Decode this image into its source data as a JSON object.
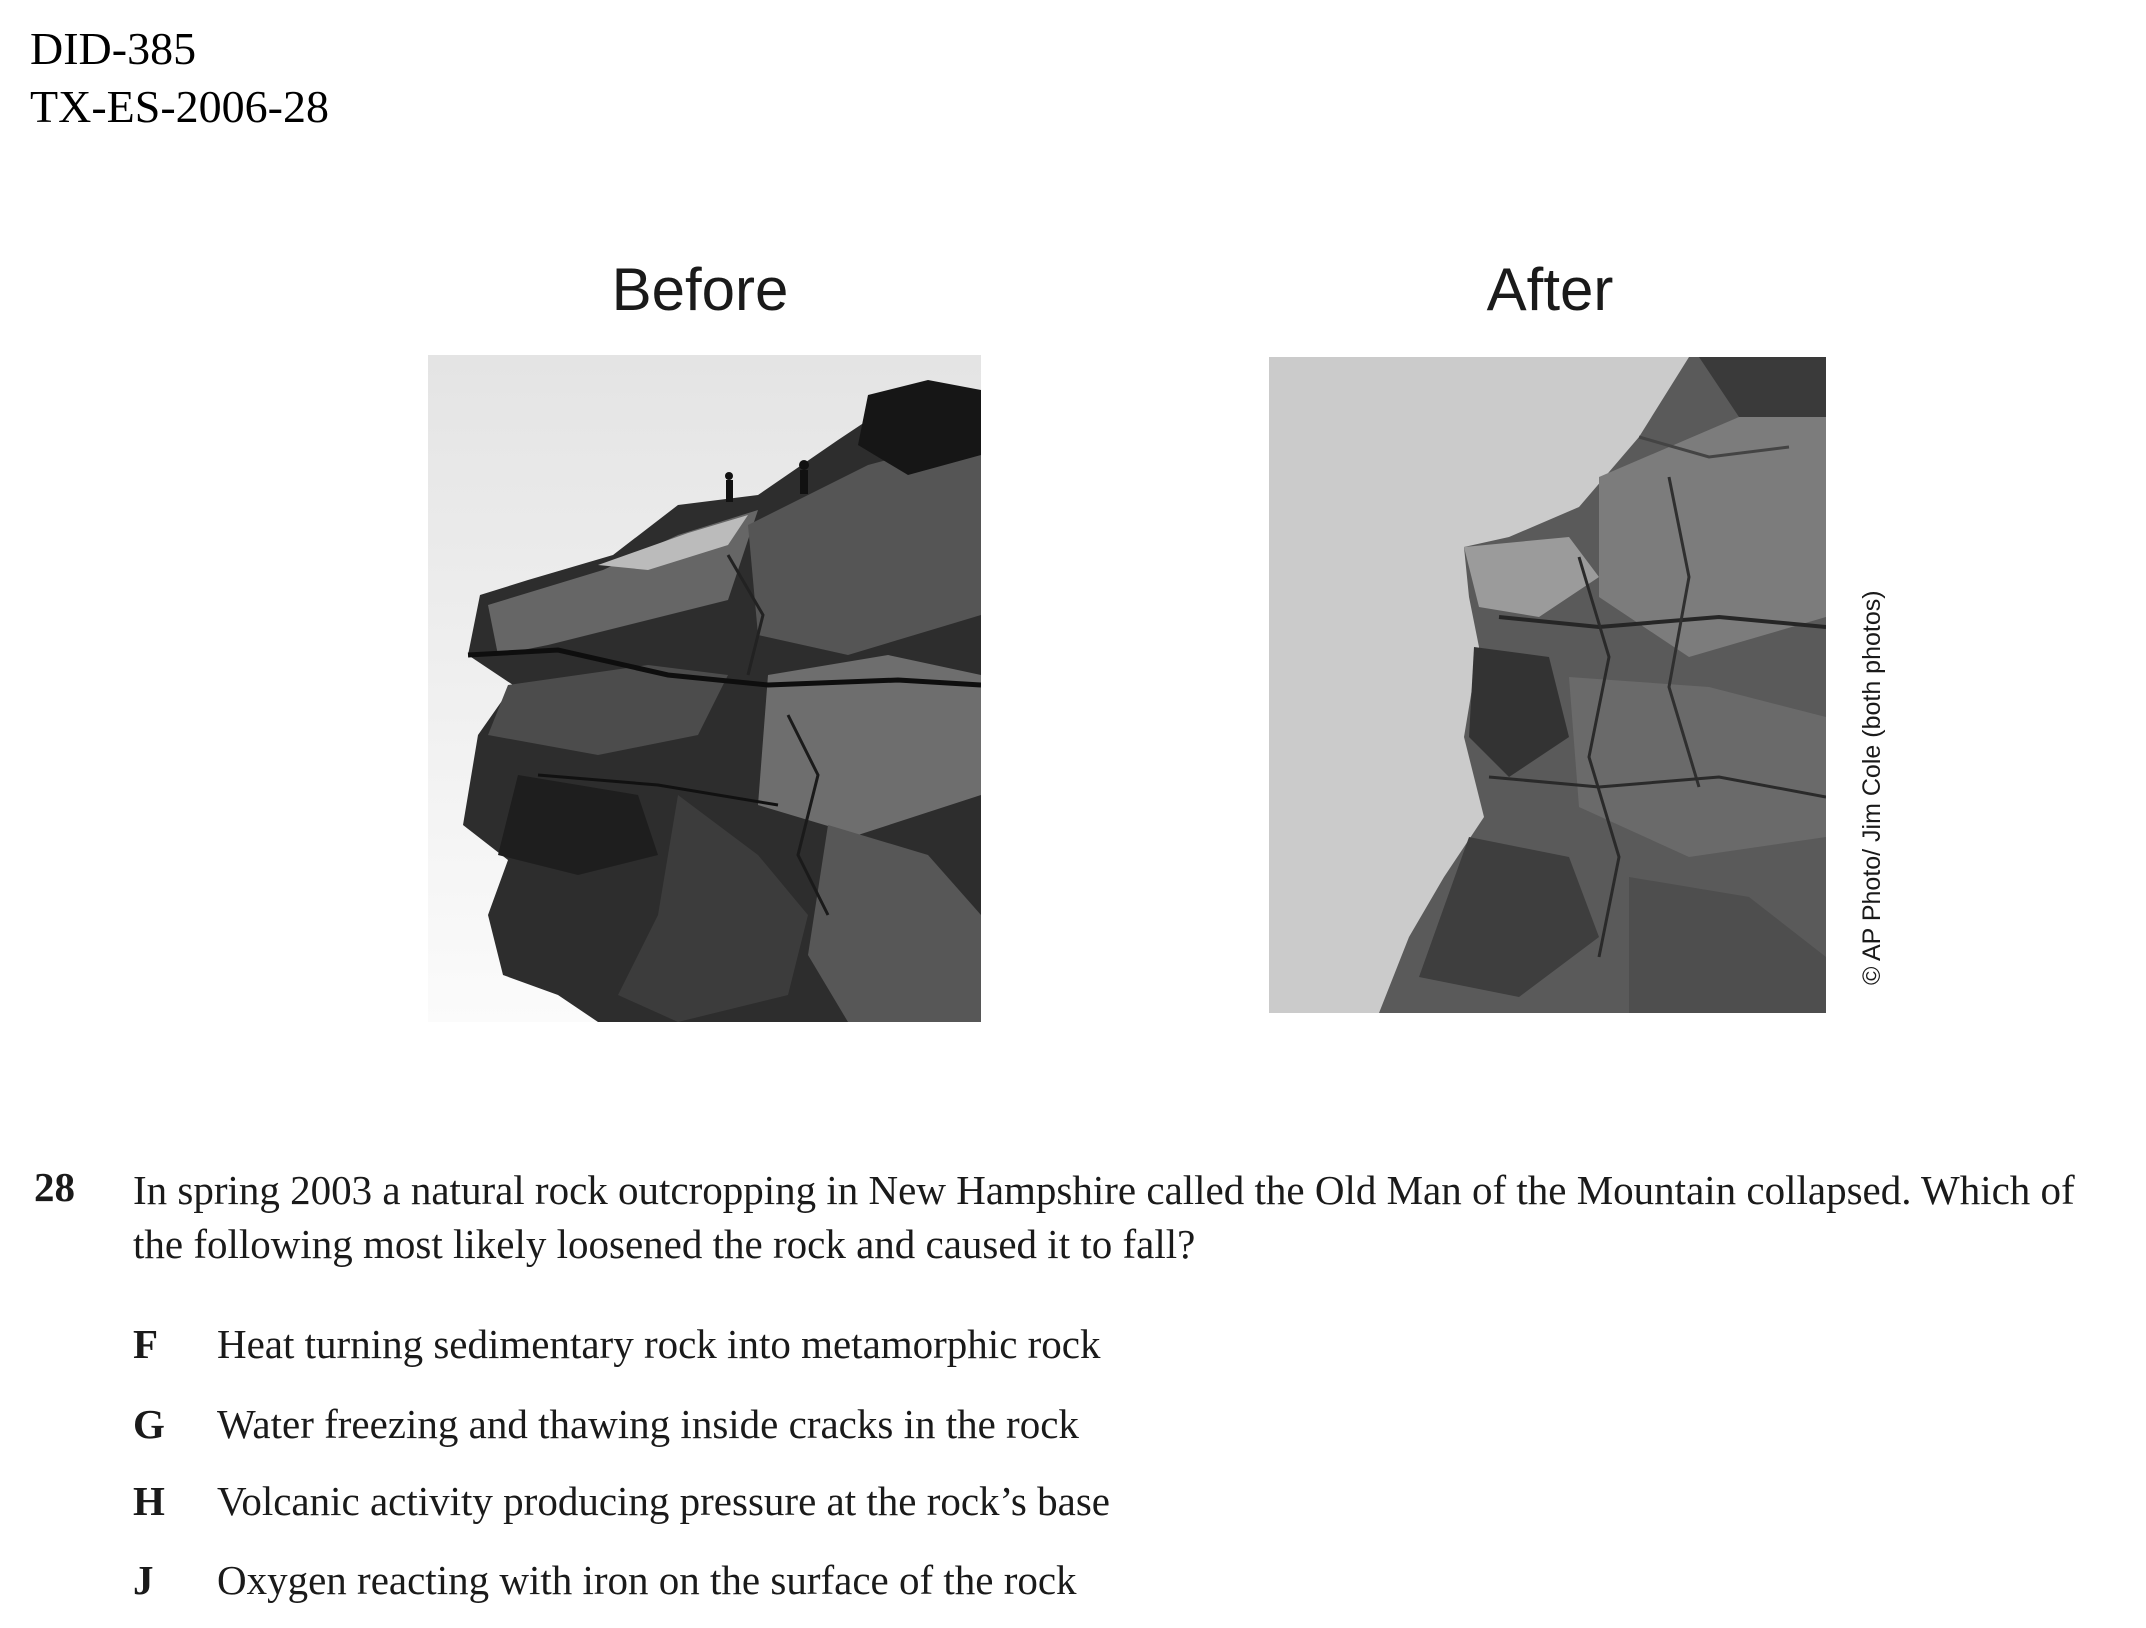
{
  "header": {
    "line1": "DID-385",
    "line2": "TX-ES-2006-28"
  },
  "figure": {
    "before_caption": "Before",
    "after_caption": "After",
    "photo_credit": "© AP Photo/ Jim Cole (both photos)"
  },
  "question": {
    "number": "28",
    "text": "In spring 2003 a natural rock outcropping in New Hampshire called the Old Man of the Mountain collapsed. Which of the following most likely loosened the rock and caused it to fall?",
    "options": [
      {
        "letter": "F",
        "text": "Heat turning sedimentary rock into metamorphic rock"
      },
      {
        "letter": "G",
        "text": "Water freezing and thawing inside cracks in the rock"
      },
      {
        "letter": "H",
        "text": "Volcanic activity producing pressure at the rock’s base"
      },
      {
        "letter": "J",
        "text": "Oxygen reacting with iron on the surface of the rock"
      }
    ]
  }
}
